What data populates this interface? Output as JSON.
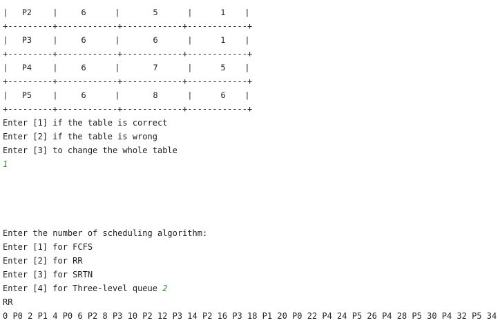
{
  "table": {
    "border": "+---------+------------+------------+------------+",
    "rows": [
      {
        "process": "P2",
        "col2": "6",
        "col3": "5",
        "col4": "1"
      },
      {
        "process": "P3",
        "col2": "6",
        "col3": "6",
        "col4": "1"
      },
      {
        "process": "P4",
        "col2": "6",
        "col3": "7",
        "col4": "5"
      },
      {
        "process": "P5",
        "col2": "6",
        "col3": "8",
        "col4": "6"
      }
    ]
  },
  "confirm_prompt": {
    "line1": "Enter [1] if the table is correct",
    "line2": "Enter [2] if the table is wrong",
    "line3": "Enter [3] to change the whole table",
    "user_input": "1"
  },
  "algorithm_prompt": {
    "header": "Enter the number of scheduling algorithm:",
    "option1": "Enter [1] for FCFS",
    "option2": "Enter [2] for RR",
    "option3": "Enter [3] for SRTN",
    "option4": "Enter [4] for Three-level queue",
    "user_input": "2"
  },
  "result": {
    "algorithm_name": "RR",
    "gantt_sequence": "0 P0 2 P1 4 P0 6 P2 8 P3 10 P2 12 P3 14 P2 16 P3 18 P1 20 P0 22 P4 24 P5 26 P4 28 P5 30 P4 32 P5 34"
  },
  "colors": {
    "text": "#1e1e1e",
    "input_echo": "#2e8b2e",
    "background": "#ffffff"
  }
}
